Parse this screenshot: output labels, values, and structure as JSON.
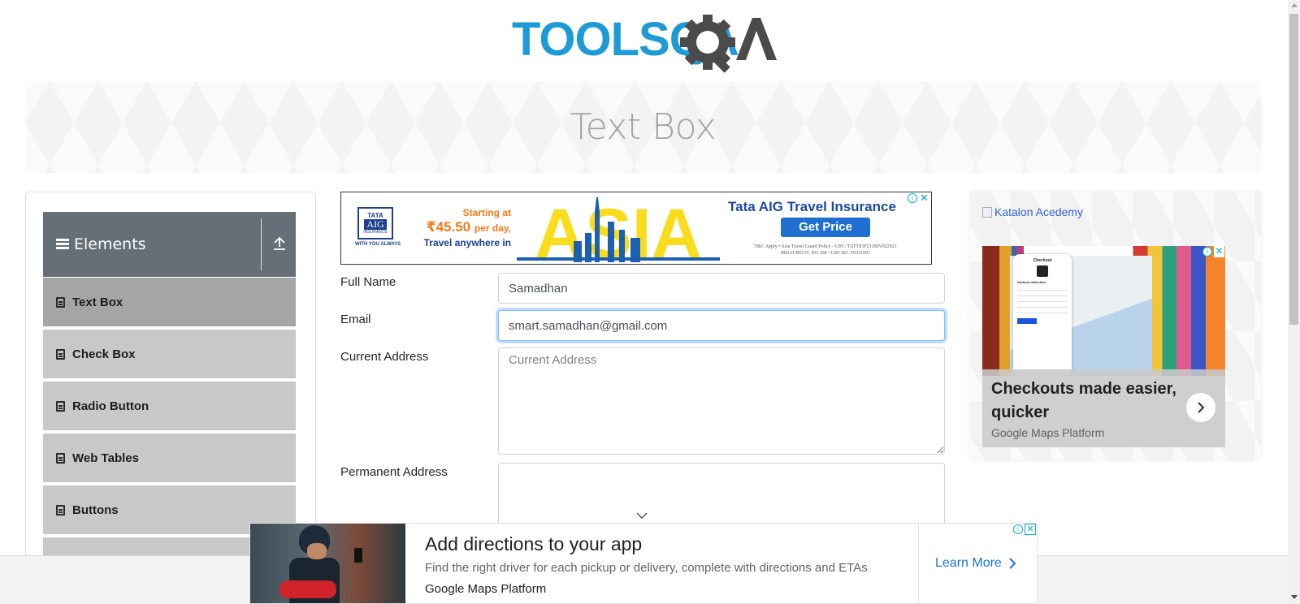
{
  "header": {
    "logo_text": "TOOLSQA",
    "logo_colors": {
      "tools": "#1e9bd7",
      "qa": "#4b4b4b"
    }
  },
  "banner": {
    "title": "Text Box"
  },
  "sidebar": {
    "group_title": "Elements",
    "items": [
      {
        "label": "Text Box",
        "active": true
      },
      {
        "label": "Check Box",
        "active": false
      },
      {
        "label": "Radio Button",
        "active": false
      },
      {
        "label": "Web Tables",
        "active": false
      },
      {
        "label": "Buttons",
        "active": false
      }
    ]
  },
  "ad_top": {
    "brand_line1": "TATA",
    "brand_line2": "AIG",
    "brand_line3": "INSURANCE",
    "brand_tagline": "WITH YOU ALWAYS",
    "starting_at": "Starting at",
    "price": "₹45.50",
    "price_unit": "per day,",
    "travel": "Travel anywhere in",
    "big_word": "ASIA",
    "title": "Tata AIG Travel Insurance",
    "cta": "Get Price",
    "fine_print_1": "T&C Apply  •  Asia Travel Guard Policy - UIN : TATTIOP21190V022021",
    "fine_print_2": "IRDAI REGN. NO.108  •  UID NO. T0321001",
    "accent_color": "#f9dc1c"
  },
  "form": {
    "full_name": {
      "label": "Full Name",
      "value": "Samadhan"
    },
    "email": {
      "label": "Email",
      "value": "smart.samadhan@gmail.com"
    },
    "current_address": {
      "label": "Current Address",
      "placeholder": "Current Address",
      "value": ""
    },
    "permanent_address": {
      "label": "Permanent Address",
      "value": ""
    }
  },
  "ad_right": {
    "broken_image_alt": "Katalon Acedemy",
    "phone_title": "Checkout",
    "phone_subtitle": "Address Selection",
    "headline": "Checkouts made easier, quicker",
    "sponsor": "Google Maps Platform"
  },
  "ad_bottom": {
    "headline": "Add directions to your app",
    "description": "Find the right driver for each pickup or delivery, complete with directions and ETAs",
    "sponsor": "Google Maps Platform",
    "cta": "Learn More"
  },
  "ad_badges": {
    "info": "i",
    "close": "✕"
  }
}
